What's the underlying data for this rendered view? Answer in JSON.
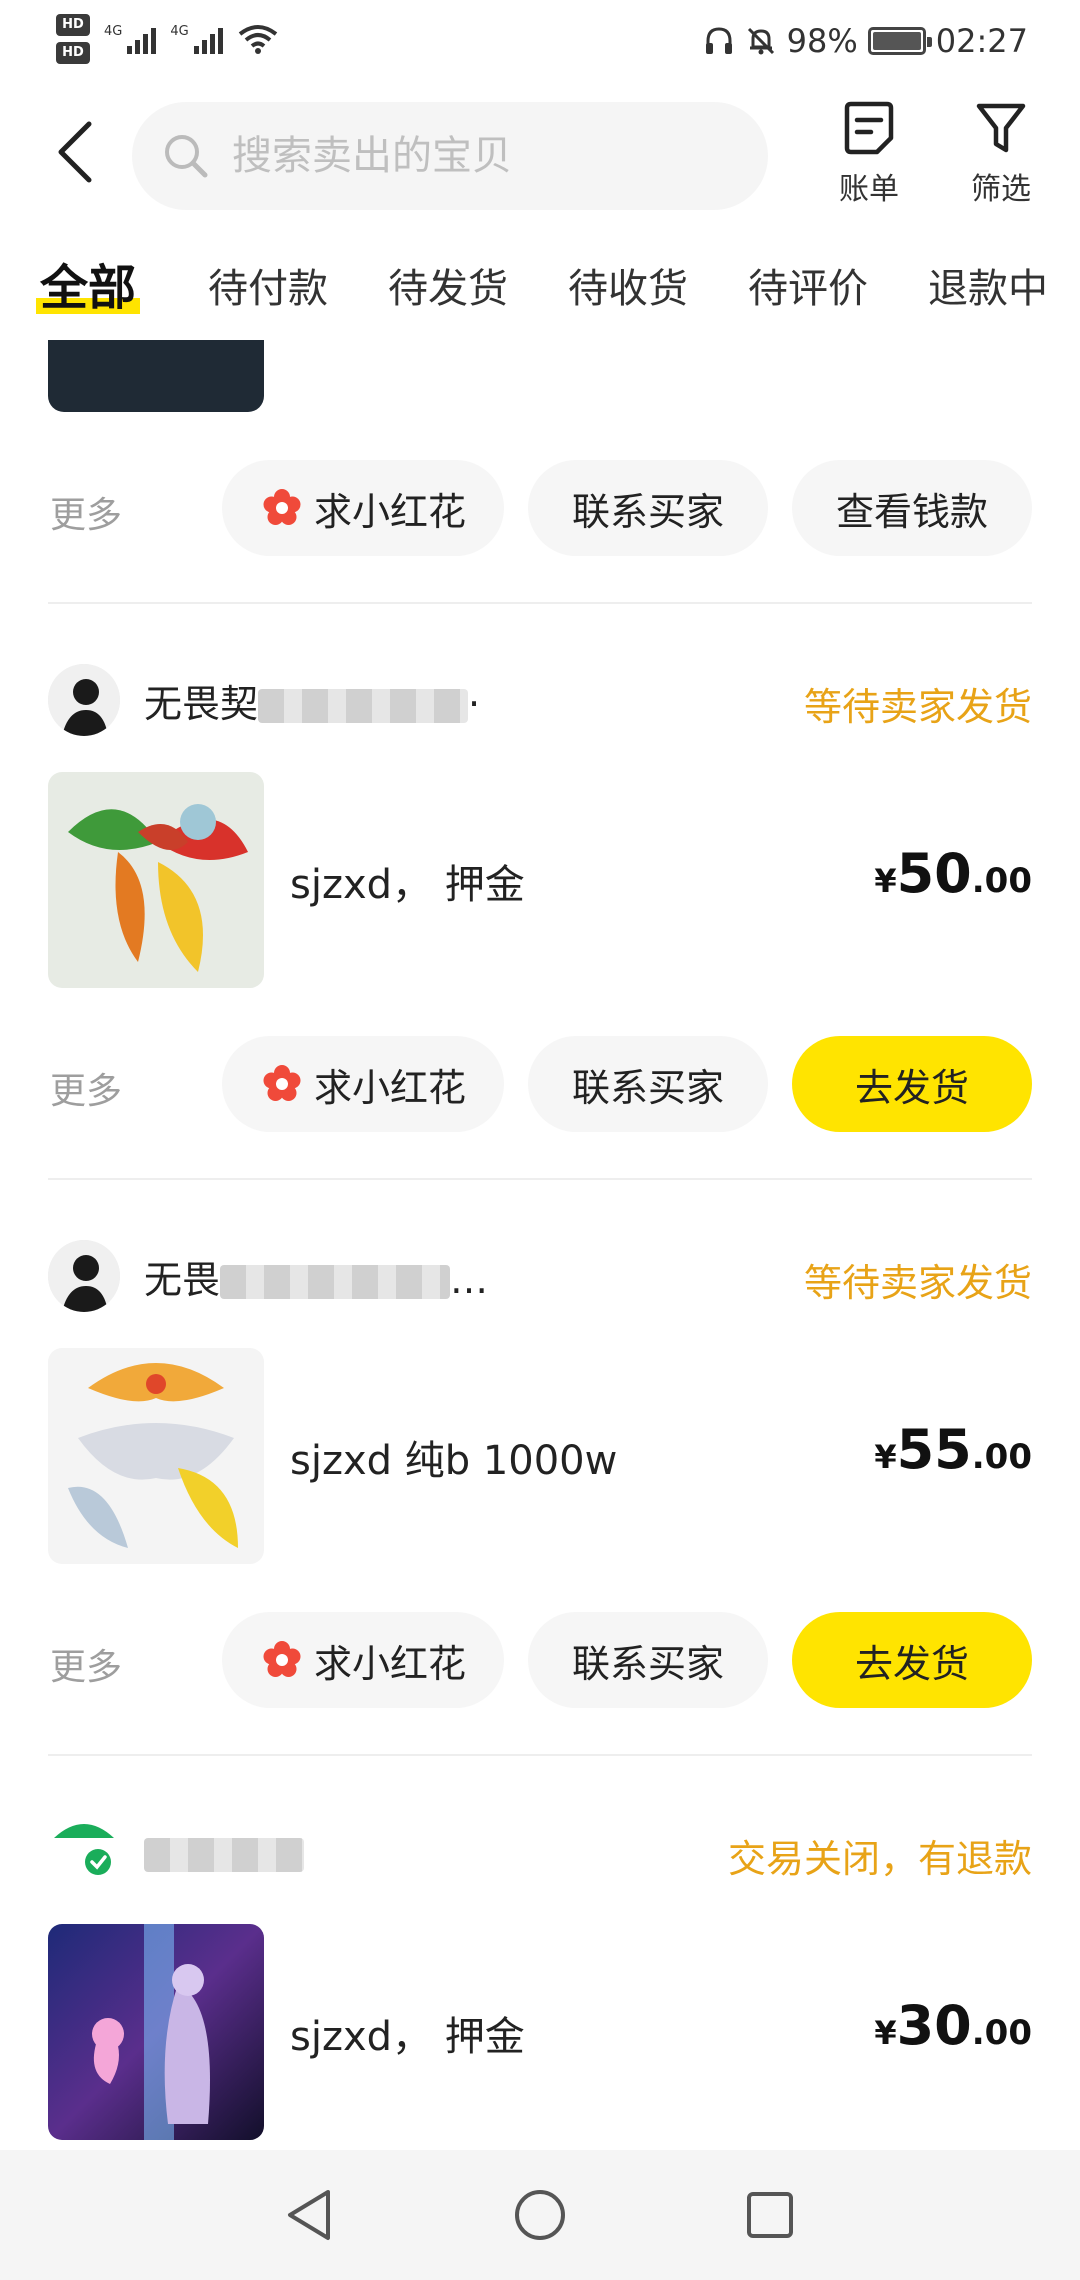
{
  "status_bar": {
    "sim1": "HD 1",
    "sim2": "HD 2",
    "net1": "4G",
    "net2": "4G",
    "battery": "98%",
    "time": "02:27"
  },
  "header": {
    "search_placeholder": "搜索卖出的宝贝",
    "bill_label": "账单",
    "filter_label": "筛选"
  },
  "tabs": [
    "全部",
    "待付款",
    "待发货",
    "待收货",
    "待评价",
    "退款中"
  ],
  "common": {
    "more": "更多",
    "flower_label": "求小红花",
    "contact_label": "联系买家"
  },
  "orders": [
    {
      "third_action": "查看钱款"
    },
    {
      "seller_prefix": "无畏契",
      "seller_suffix": "·",
      "status": "等待卖家发货",
      "title": "sjzxd， 押金",
      "price_currency": "¥",
      "price_int": "50",
      "price_dec": ".00",
      "primary_action": "去发货"
    },
    {
      "seller_prefix": "无畏",
      "seller_suffix": "…",
      "status": "等待卖家发货",
      "title": "sjzxd 纯b 1000w",
      "price_currency": "¥",
      "price_int": "55",
      "price_dec": ".00",
      "primary_action": "去发货"
    },
    {
      "seller_prefix": "",
      "seller_suffix": "",
      "status": "交易关闭，有退款",
      "title": "sjzxd， 押金",
      "price_currency": "¥",
      "price_int": "30",
      "price_dec": ".00"
    }
  ],
  "colors": {
    "accent_yellow": "#ffe400",
    "status_orange": "#e8a317",
    "flower_red": "#f04a3a"
  },
  "icons": [
    "back-arrow-icon",
    "search-icon",
    "bill-icon",
    "filter-icon",
    "flower-icon",
    "nav-back-icon",
    "nav-home-icon",
    "nav-recents-icon"
  ]
}
